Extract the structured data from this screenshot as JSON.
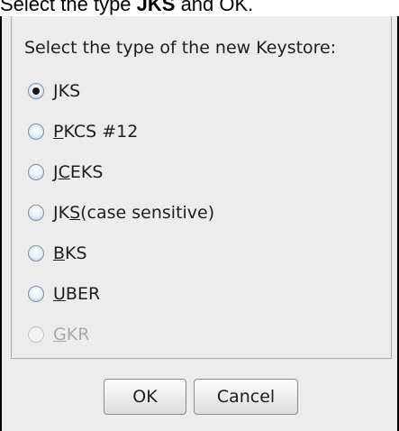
{
  "caption": {
    "prefix": "Select the type ",
    "bold": "JKS",
    "suffix": " and OK."
  },
  "dialog": {
    "prompt": "Select the type of the new Keystore:",
    "options": [
      {
        "pre": "",
        "mnemonic": "J",
        "post": "KS",
        "checked": true,
        "enabled": true
      },
      {
        "pre": "",
        "mnemonic": "P",
        "post": "KCS #12",
        "checked": false,
        "enabled": true
      },
      {
        "pre": "J",
        "mnemonic": "C",
        "post": "EKS",
        "checked": false,
        "enabled": true
      },
      {
        "pre": "JK",
        "mnemonic": "S",
        "post": " (case sensitive)",
        "checked": false,
        "enabled": true
      },
      {
        "pre": "",
        "mnemonic": "B",
        "post": "KS",
        "checked": false,
        "enabled": true
      },
      {
        "pre": "",
        "mnemonic": "U",
        "post": "BER",
        "checked": false,
        "enabled": true
      },
      {
        "pre": "",
        "mnemonic": "G",
        "post": "KR",
        "checked": false,
        "enabled": false
      }
    ],
    "ok_label": "OK",
    "cancel_label": "Cancel"
  }
}
